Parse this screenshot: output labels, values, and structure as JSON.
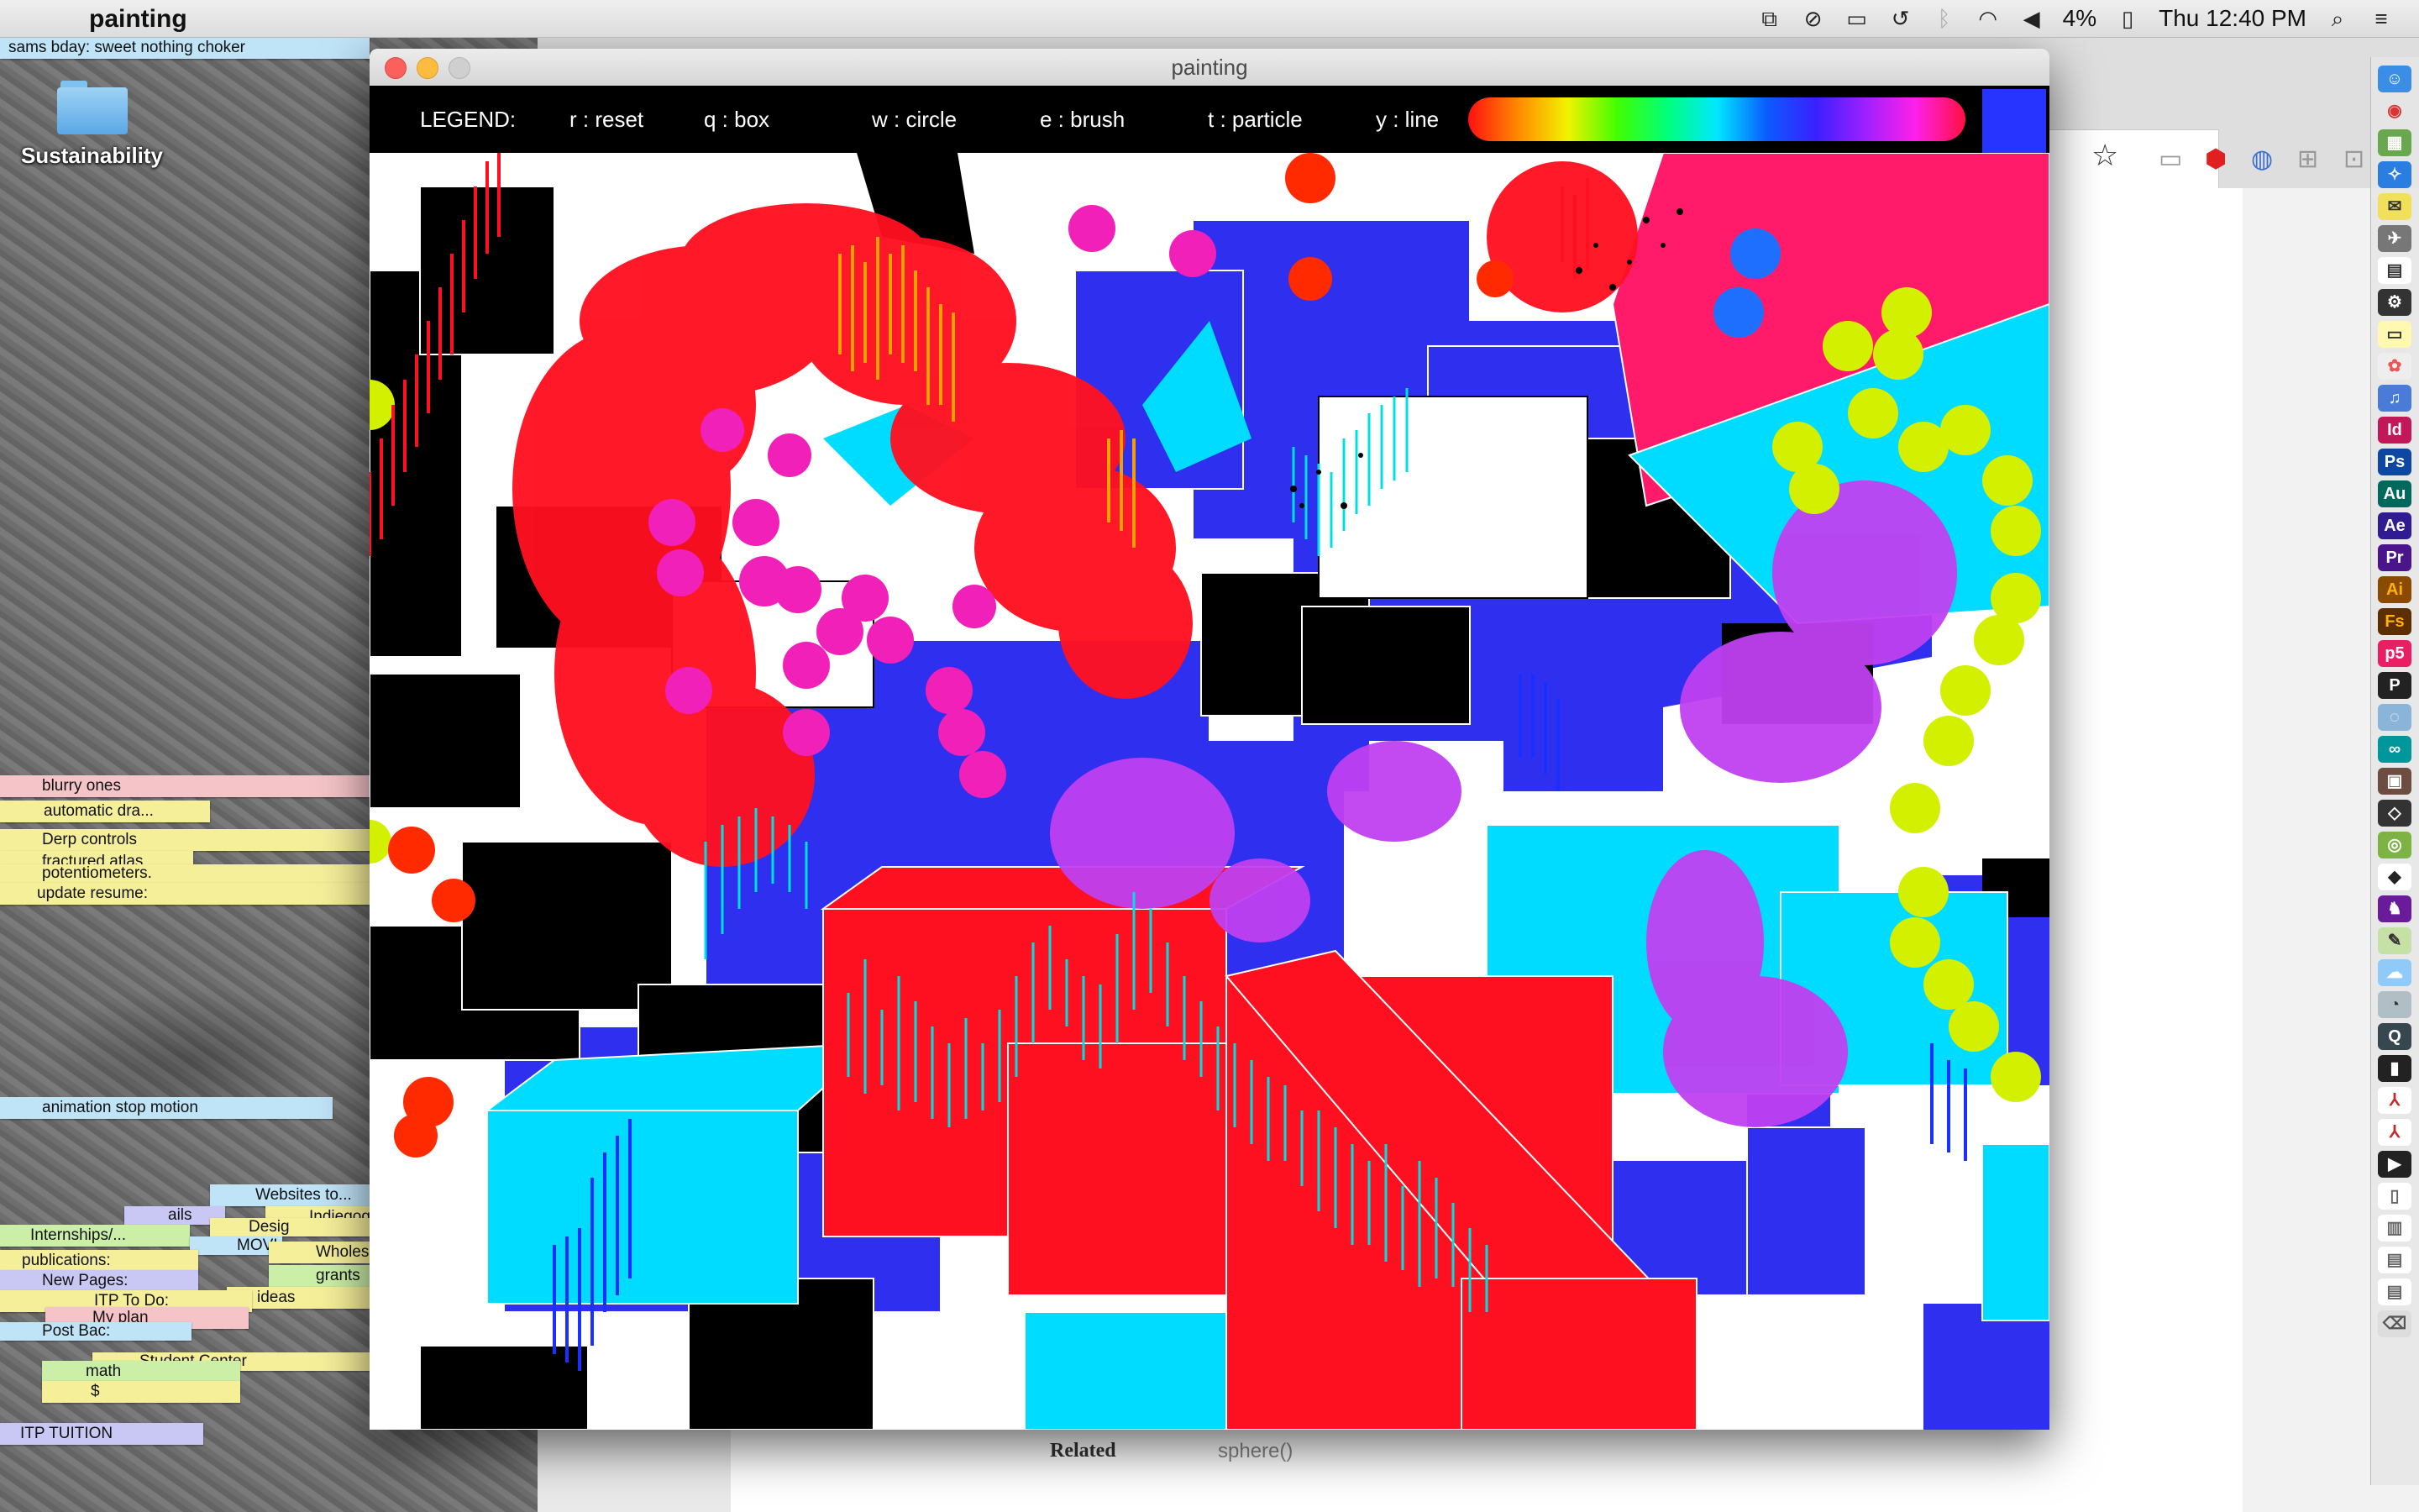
{
  "menubar": {
    "app_name": "painting",
    "battery": "4%",
    "clock": "Thu 12:40 PM",
    "icons": [
      "mirror-icon",
      "do-not-disturb-icon",
      "airplay-icon",
      "time-machine-icon",
      "bluetooth-icon",
      "wifi-icon",
      "volume-icon",
      "battery-icon",
      "search-icon",
      "list-icon"
    ]
  },
  "desktop": {
    "folder_label": "Sustainability",
    "stickies": [
      {
        "text": "sams bday: sweet nothing choker",
        "color": "blue"
      },
      {
        "text": "blurry ones",
        "color": "pink"
      },
      {
        "text": "automatic dra...",
        "color": "yellow"
      },
      {
        "text": "Derp controls",
        "color": "yellow"
      },
      {
        "text": "fractured atlas",
        "color": "yellow"
      },
      {
        "text": "potentiometers.",
        "color": "yellow"
      },
      {
        "text": "update resume:",
        "color": "yellow"
      },
      {
        "text": "animation stop motion",
        "color": "blue"
      },
      {
        "text": "Websites to...",
        "color": "blue"
      },
      {
        "text": "ails",
        "color": "purple"
      },
      {
        "text": "Indiegog",
        "color": "yellow"
      },
      {
        "text": "Internships/...",
        "color": "green"
      },
      {
        "text": "Desig",
        "color": "yellow"
      },
      {
        "text": "MOVI",
        "color": "blue"
      },
      {
        "text": "Wholes",
        "color": "yellow"
      },
      {
        "text": "publications:",
        "color": "yellow"
      },
      {
        "text": "grants",
        "color": "green"
      },
      {
        "text": "New Pages:",
        "color": "purple"
      },
      {
        "text": "ideas",
        "color": "yellow"
      },
      {
        "text": "ITP To Do:",
        "color": "yellow"
      },
      {
        "text": "My plan",
        "color": "pink"
      },
      {
        "text": "Post Bac:",
        "color": "blue"
      },
      {
        "text": "Student Center",
        "color": "yellow"
      },
      {
        "text": "math",
        "color": "green"
      },
      {
        "text": "$",
        "color": "yellow"
      },
      {
        "text": "ITP TUITION",
        "color": "purple"
      }
    ]
  },
  "browser": {
    "related_label": "Related",
    "sphere_label": "sphere()"
  },
  "window": {
    "title": "painting",
    "legend": {
      "label": "LEGEND:",
      "reset": "r : reset",
      "box": "q : box",
      "circle": "w : circle",
      "brush": "e : brush",
      "particle": "t : particle",
      "line": "y : line"
    },
    "current_color": "#2733ff"
  },
  "colors": {
    "red": "#ff1020",
    "blue": "#2f2fef",
    "cyan": "#00dcff",
    "magenta": "#f020b8",
    "purple": "#c040f0",
    "lime": "#d2f000",
    "pink": "#ff1a6a",
    "orange": "#f0a000"
  },
  "dock": {
    "apps": [
      "finder-icon",
      "chrome-icon",
      "photos-icon",
      "safari-icon",
      "mail-icon",
      "launchpad-icon",
      "calendar-icon",
      "terminal-icon",
      "notes-icon",
      "photos-icon",
      "itunes-icon",
      "indesign-icon",
      "photoshop-icon",
      "audition-icon",
      "after-effects-icon",
      "premiere-icon",
      "illustrator-icon",
      "flash-icon",
      "p5-icon",
      "processing-icon",
      "cura-icon",
      "arduino-icon",
      "disk-icon",
      "unity-icon",
      "gear-icon",
      "unity-icon",
      "github-icon",
      "scripteditor-icon",
      "icloud-icon",
      "cyberduck-icon",
      "quicktime-icon",
      "terminal-icon",
      "acrobat-icon",
      "acrobat-icon",
      "itunes-icon",
      "document-icon",
      "image-icon",
      "screenshot-icon",
      "screenshot-icon",
      "trash-icon"
    ]
  }
}
